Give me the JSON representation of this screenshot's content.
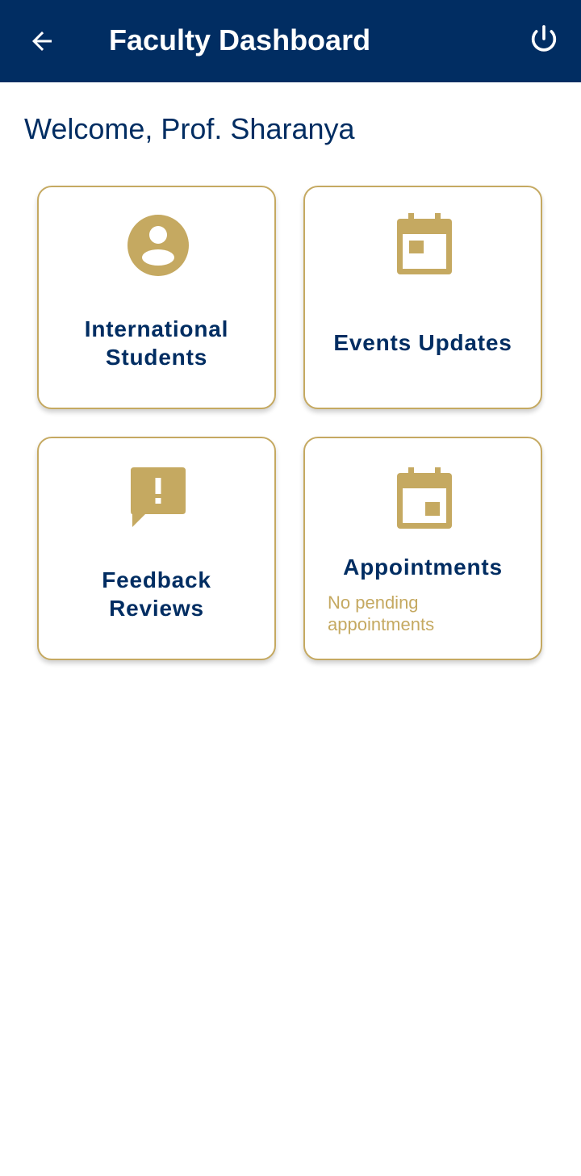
{
  "app_bar": {
    "title": "Faculty Dashboard",
    "back_icon": "arrow-left-icon",
    "power_icon": "power-icon"
  },
  "welcome": "Welcome, Prof. Sharanya",
  "colors": {
    "primary": "#012d62",
    "accent": "#c5a961",
    "background": "#ffffff"
  },
  "cards": [
    {
      "icon": "account-circle-icon",
      "label_line1": "International",
      "label_line2": "Students"
    },
    {
      "icon": "calendar-event-icon",
      "label": "Events Updates"
    },
    {
      "icon": "feedback-icon",
      "label_line1": "Feedback",
      "label_line2": "Reviews"
    },
    {
      "icon": "calendar-icon",
      "label": "Appointments",
      "subtext_line1": "No pending",
      "subtext_line2": "appointments"
    }
  ]
}
